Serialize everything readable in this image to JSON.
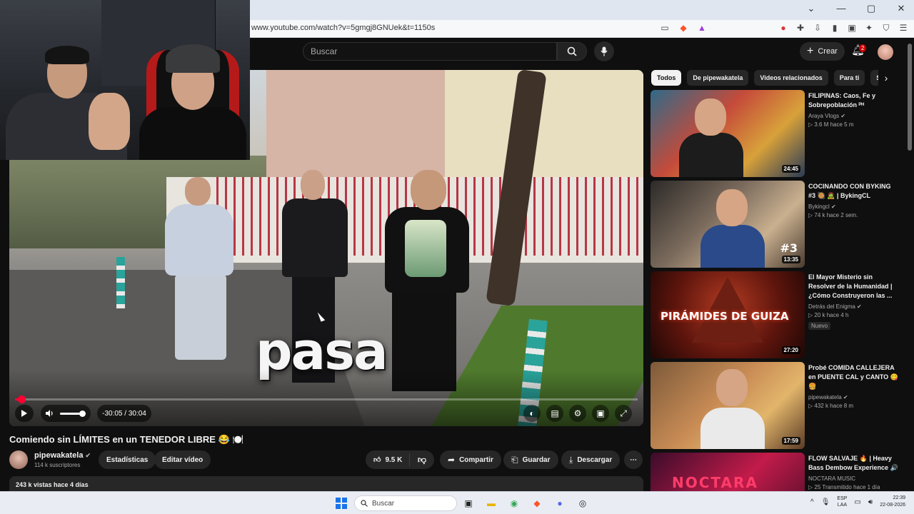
{
  "browser": {
    "url": "www.youtube.com/watch?v=5gmgj8GNUek&t=1150s",
    "window_controls": [
      "⌄",
      "—",
      "▢",
      "✕"
    ]
  },
  "header": {
    "search_placeholder": "Buscar",
    "create_label": "Crear",
    "notification_count": "2"
  },
  "video": {
    "caption_overlay": "pasa",
    "time_display": "-30:05 / 30:04",
    "progress_fraction": 0.01,
    "volume_fraction": 1.0,
    "title": "Comiendo sin LÍMITES en un TENEDOR LIBRE 😂 🍽️",
    "channel": "pipewakatela",
    "subscribers": "114 k suscriptores",
    "views_date": "243 k vistas  hace 4 días"
  },
  "actions": {
    "stats": "Estadísticas",
    "edit": "Editar vídeo",
    "likes": "9.5 K",
    "share": "Compartir",
    "save": "Guardar",
    "download": "Descargar",
    "more": "⋯"
  },
  "chips": [
    "Todos",
    "De pipewakatela",
    "Videos relacionados",
    "Para ti",
    "Su"
  ],
  "recommendations": [
    {
      "title": "FILIPINAS: Caos, Fe y Sobrepoblación ᴾᴴ",
      "channel": "Araya Vlogs ✔",
      "stats": "▷ 3.6 M  hace 5 m",
      "duration": "24:45",
      "badge": ""
    },
    {
      "title": "COCINANDO CON BYKING #3 🥘 🧟 | BykingCL",
      "channel": "Bykingcl ✔",
      "stats": "▷ 74 k  hace 2 sem.",
      "duration": "13:35",
      "badge": ""
    },
    {
      "title": "El Mayor Misterio sin Resolver de la Humanidad | ¿Cómo Construyeron las ...",
      "channel": "Detrás del Enigma ✔",
      "stats": "▷ 20 k  hace 4 h",
      "duration": "27:20",
      "badge": "Nuevo"
    },
    {
      "title": "Probé COMIDA CALLEJERA en PUENTE CAL y CANTO 😋 🍔",
      "channel": "pipewakatela ✔",
      "stats": "▷ 432 k  hace 8 m",
      "duration": "17:59",
      "badge": ""
    },
    {
      "title": "FLOW SALVAJE 🔥 | Heavy Bass Dembow Experience 🔊",
      "channel": "NOCTARA MUSIC",
      "stats": "▷ 25  Transmitido hace 1 día",
      "duration": "",
      "badge": ""
    }
  ],
  "thumbnail_text": {
    "pyramids": "PIRÁMIDES DE GUIZA",
    "noctara": "NOCTARA",
    "byking_number": "#3"
  },
  "taskbar": {
    "search_label": "Buscar",
    "lang_top": "ESP",
    "lang_bottom": "LAA",
    "time": "22:39",
    "date": "22-08-2026"
  },
  "colors": {
    "yt_background": "#0f0f0f",
    "progress_red": "#ff0033",
    "chip_active": "#f1f1f1"
  }
}
